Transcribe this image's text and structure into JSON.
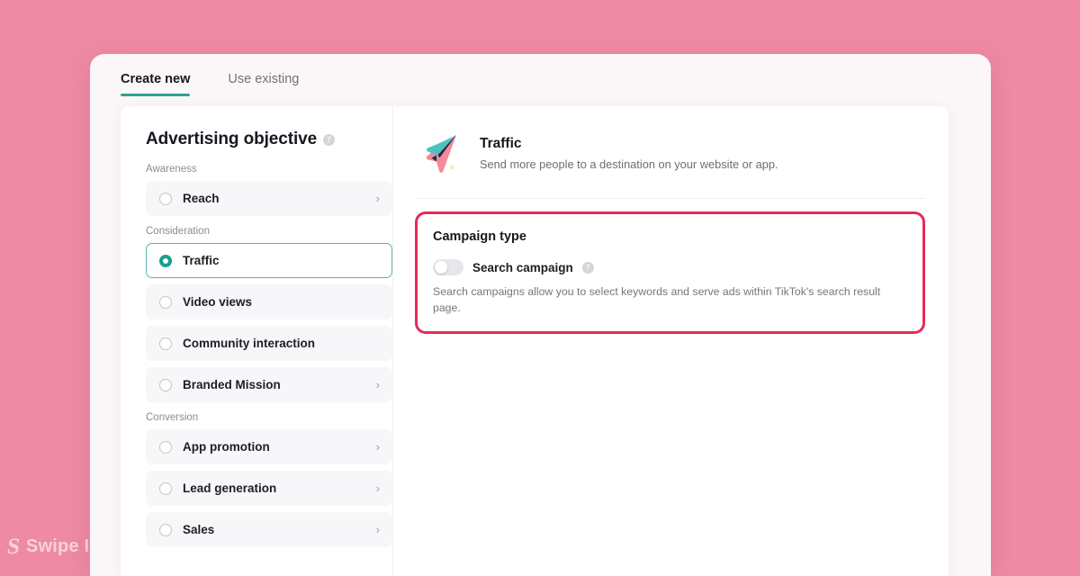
{
  "watermark": {
    "mark": "S",
    "text": "Swipe Ins"
  },
  "tabs": [
    {
      "label": "Create new",
      "active": true
    },
    {
      "label": "Use existing",
      "active": false
    }
  ],
  "objective_panel": {
    "title": "Advertising objective",
    "info_icon": "?",
    "groups": [
      {
        "label": "Awareness",
        "items": [
          {
            "label": "Reach",
            "selected": false,
            "chevron": true
          }
        ]
      },
      {
        "label": "Consideration",
        "items": [
          {
            "label": "Traffic",
            "selected": true,
            "chevron": false
          },
          {
            "label": "Video views",
            "selected": false,
            "chevron": false
          },
          {
            "label": "Community interaction",
            "selected": false,
            "chevron": false
          },
          {
            "label": "Branded Mission",
            "selected": false,
            "chevron": true
          }
        ]
      },
      {
        "label": "Conversion",
        "items": [
          {
            "label": "App promotion",
            "selected": false,
            "chevron": true
          },
          {
            "label": "Lead generation",
            "selected": false,
            "chevron": true
          },
          {
            "label": "Sales",
            "selected": false,
            "chevron": true
          }
        ]
      }
    ]
  },
  "detail": {
    "icon_name": "traffic-paper-plane-icon",
    "name": "Traffic",
    "description": "Send more people to a destination on your website or app."
  },
  "campaign_type": {
    "title": "Campaign type",
    "toggle_label": "Search campaign",
    "toggle_on": false,
    "info_icon": "?",
    "description": "Search campaigns allow you to select keywords and serve ads within TikTok's search result page."
  },
  "colors": {
    "background": "#ee8aa4",
    "accent_teal": "#2fa094",
    "highlight_red": "#e62a59",
    "panel": "#ffffff",
    "shell": "#fbf7f9"
  }
}
